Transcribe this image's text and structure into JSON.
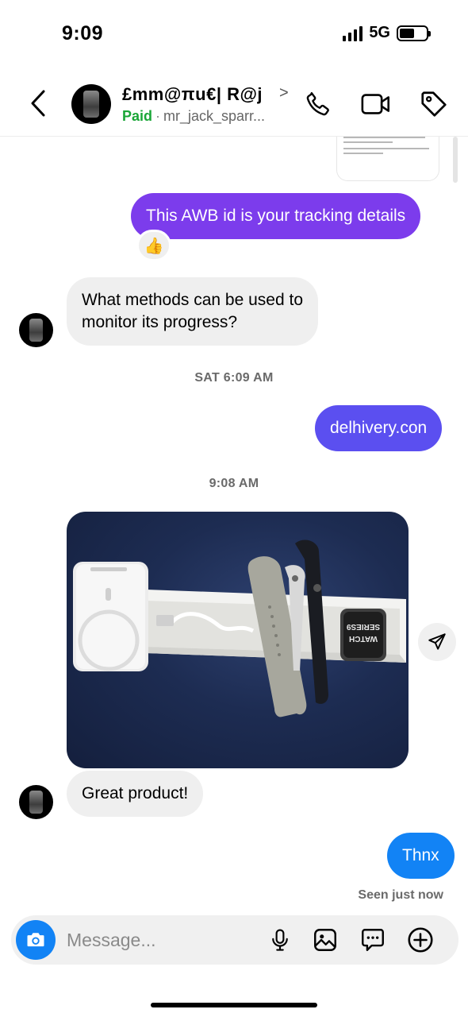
{
  "status_bar": {
    "time": "9:09",
    "network": "5G",
    "battery_level": 0.55
  },
  "header": {
    "contact_name": "£mm@πu€| R@j",
    "chevron": ">",
    "paid_label": "Paid",
    "separator": "·",
    "username": "mr_jack_sparr..."
  },
  "messages": [
    {
      "direction": "out",
      "text": "This AWB id is your tracking details",
      "reaction": "👍"
    },
    {
      "direction": "in",
      "lines": [
        "What methods can be used to",
        "monitor its progress?"
      ]
    },
    {
      "type": "timestamp",
      "text": "SAT 6:09 AM"
    },
    {
      "direction": "out",
      "text": "delhivery.con"
    },
    {
      "type": "timestamp",
      "text": "9:08 AM"
    },
    {
      "direction": "in",
      "type": "photo",
      "printed_text": [
        "WATCH",
        "SERIES9"
      ]
    },
    {
      "direction": "in",
      "text": "Great product!"
    },
    {
      "direction": "out",
      "text": "Thnx"
    }
  ],
  "seen_status": "Seen just now",
  "composer": {
    "placeholder": "Message..."
  },
  "icons": {
    "back": "chevron-left-icon",
    "call": "phone-icon",
    "video": "video-camera-icon",
    "tag": "tag-icon",
    "share": "send-icon",
    "camera": "camera-icon",
    "mic": "microphone-icon",
    "gallery": "image-icon",
    "sticker": "chat-bubble-icon",
    "more": "plus-circle-icon"
  },
  "colors": {
    "purple_bubble": "#7c3cec",
    "indigo_bubble": "#5b4ff0",
    "blue_bubble": "#1283f5",
    "incoming_bubble": "#efefef",
    "paid_green": "#1aa637"
  }
}
